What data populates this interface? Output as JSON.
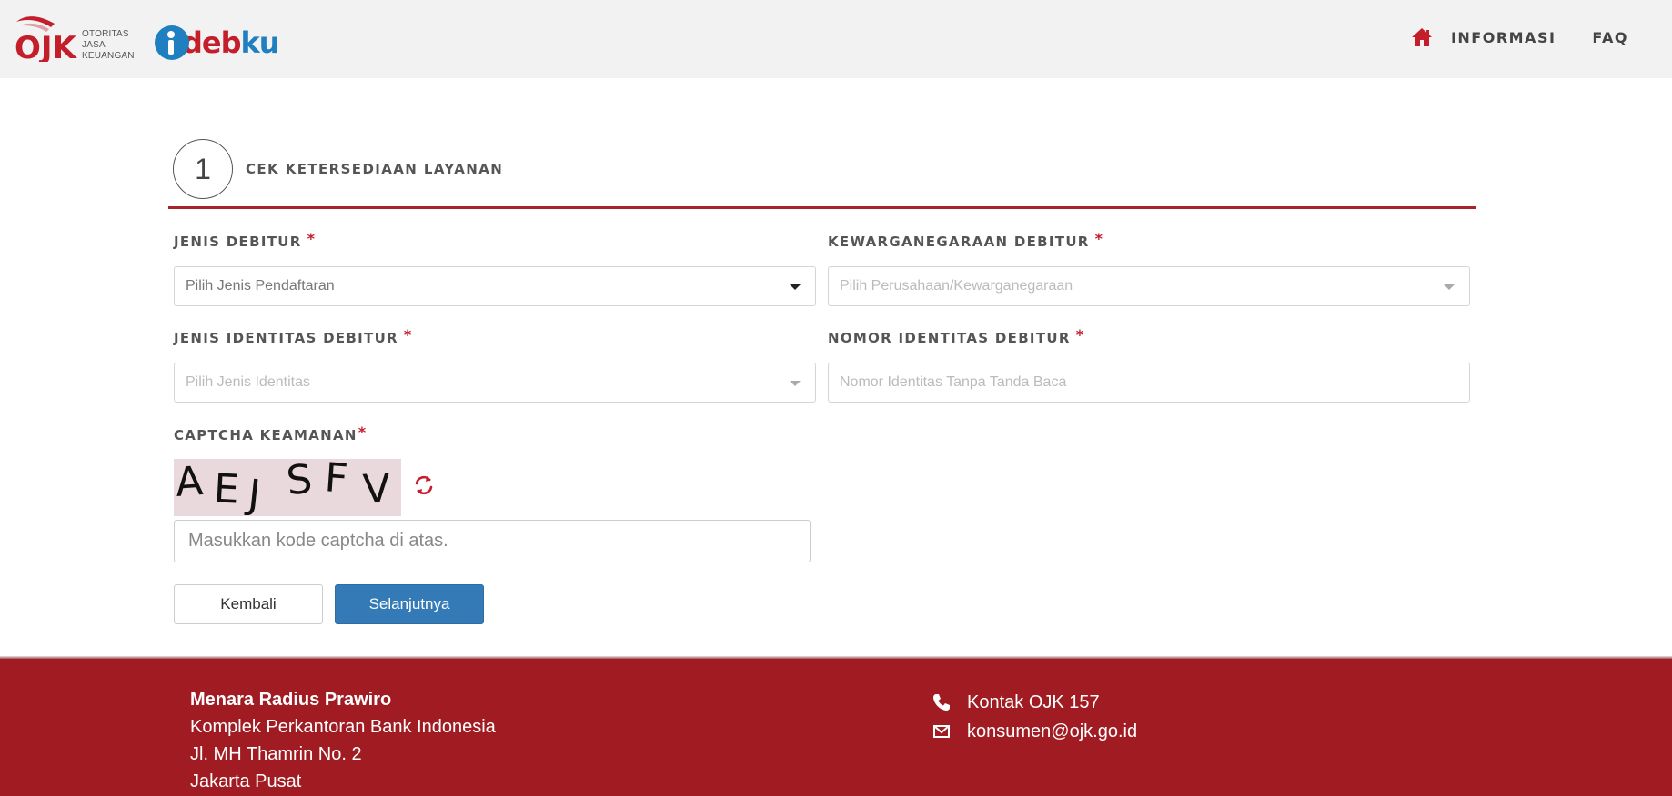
{
  "header": {
    "ojk_logo_text": [
      "OTORITAS",
      "JASA",
      "KEUANGAN"
    ],
    "ojk_logo_mark": "OJK",
    "idebku_logo": {
      "part1": "deb",
      "part2": "ku"
    },
    "nav": {
      "informasi": "INFORMASI",
      "faq": "FAQ"
    },
    "colors": {
      "brand_red": "#c41e2b",
      "brand_blue": "#1f7fc1"
    }
  },
  "step": {
    "number": "1",
    "label": "CEK KETERSEDIAAN LAYANAN"
  },
  "form": {
    "jenis_debitur": {
      "label": "JENIS DEBITUR",
      "required": "*",
      "placeholder": "Pilih Jenis Pendaftaran"
    },
    "kewarganegaraan": {
      "label": "KEWARGANEGARAAN DEBITUR",
      "required": "*",
      "placeholder": "Pilih Perusahaan/Kewarganegaraan"
    },
    "jenis_identitas": {
      "label": "JENIS IDENTITAS DEBITUR",
      "required": "*",
      "placeholder": "Pilih Jenis Identitas"
    },
    "nomor_identitas": {
      "label": "NOMOR IDENTITAS DEBITUR",
      "required": "*",
      "placeholder": "Nomor Identitas Tanpa Tanda Baca"
    },
    "captcha": {
      "label": "CAPTCHA KEAMANAN",
      "required": "*",
      "chars": [
        "A",
        "E",
        "J",
        "S",
        "F",
        "V"
      ],
      "input_placeholder": "Masukkan kode captcha di atas."
    }
  },
  "buttons": {
    "back": "Kembali",
    "next": "Selanjutnya"
  },
  "footer": {
    "address": {
      "name": "Menara Radius Prawiro",
      "line1": "Komplek Perkantoran Bank Indonesia",
      "line2": "Jl. MH Thamrin No. 2",
      "line3": "Jakarta Pusat"
    },
    "contact": {
      "phone": "Kontak OJK 157",
      "email": "konsumen@ojk.go.id"
    },
    "background": "#a01c22"
  }
}
